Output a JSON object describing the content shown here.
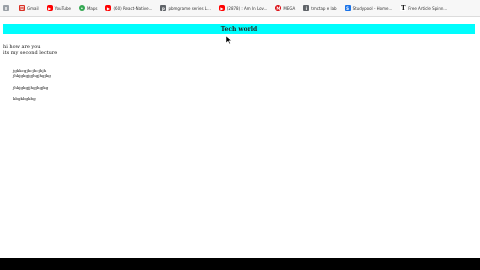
{
  "bookmarks": [
    {
      "icon": "apps-grid-icon",
      "label": "⠿",
      "fav": "grid",
      "text": ""
    },
    {
      "icon": "gmail-icon",
      "label": "M",
      "fav": "gmail",
      "text": "Gmail"
    },
    {
      "icon": "youtube-icon",
      "label": "▶",
      "fav": "yt",
      "text": "YouTube"
    },
    {
      "icon": "maps-icon",
      "label": "•",
      "fav": "maps",
      "text": "Maps"
    },
    {
      "icon": "video-icon",
      "label": "▶",
      "fav": "yt",
      "text": "(60) React-Native..."
    },
    {
      "icon": "page-icon",
      "label": "p",
      "fav": "ext",
      "text": "pbmgrame series L..."
    },
    {
      "icon": "youtube-icon",
      "label": "▶",
      "fav": "yt",
      "text": "(2878) : Am In Lov..."
    },
    {
      "icon": "mega-icon",
      "label": "M",
      "fav": "mega",
      "text": "MEGA"
    },
    {
      "icon": "page-icon",
      "label": "i",
      "fav": "ext",
      "text": "tmctap e lab"
    },
    {
      "icon": "studypool-icon",
      "label": "S",
      "fav": "doc",
      "text": "Studypool - Home..."
    },
    {
      "icon": "typewriter-icon",
      "label": "T",
      "fav": "tt",
      "text": "Free Article Spinn..."
    }
  ],
  "page": {
    "banner_title": "Tech world",
    "greeting": "hi how are you",
    "subtitle": "its my second lecture",
    "para1_line1": "jgkkcgjhcjhcjhjh",
    "para1_line2": "jhkjgkgjgjhgjhgjkg",
    "para2_line1": "jhkjgkgjjhgjhgjkg",
    "para3_line1": "kbgkbgkbg"
  }
}
